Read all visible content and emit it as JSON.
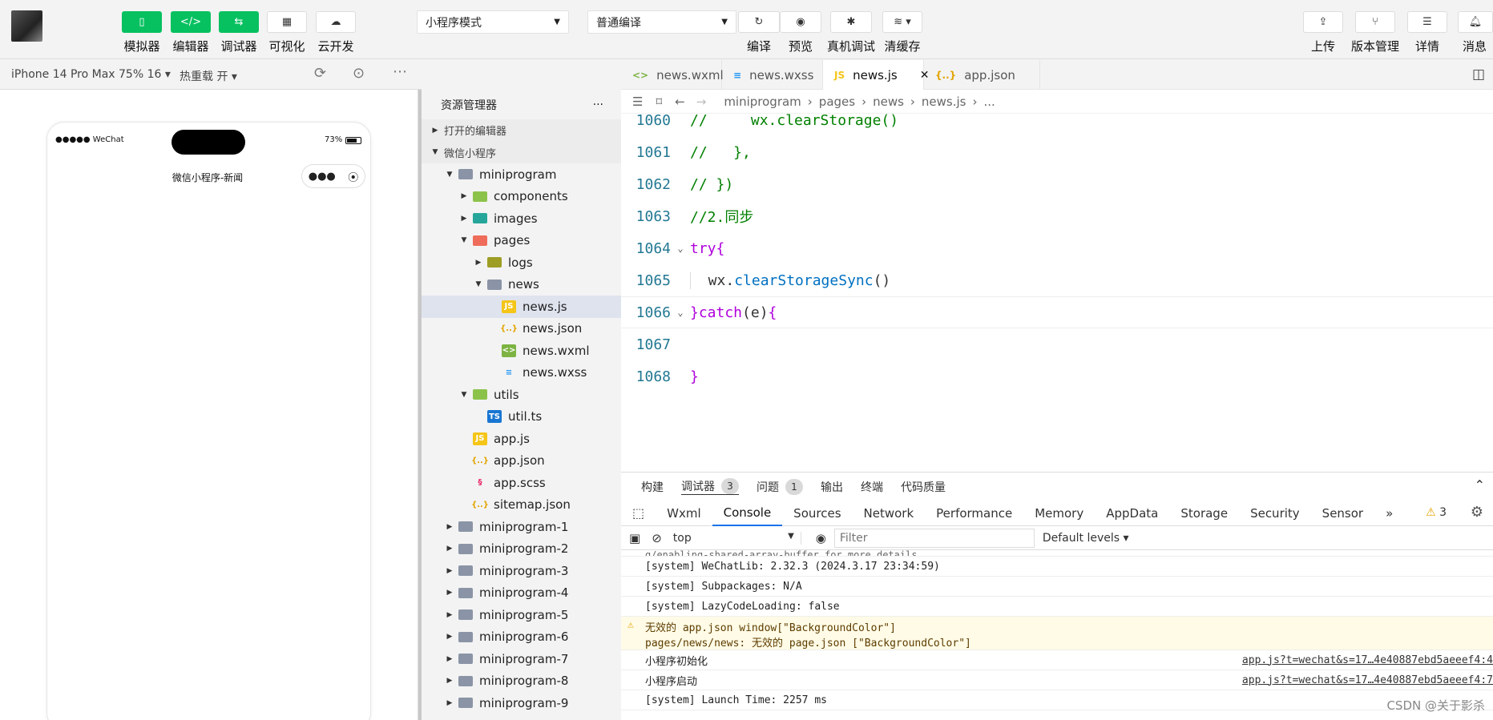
{
  "toolbar": {
    "buttons": [
      {
        "label": "模拟器",
        "icon": "phone-icon"
      },
      {
        "label": "编辑器",
        "icon": "code-icon"
      },
      {
        "label": "调试器",
        "icon": "sliders-icon"
      },
      {
        "label": "可视化",
        "icon": "layout-icon"
      },
      {
        "label": "云开发",
        "icon": "cloud-icon"
      }
    ],
    "mode_select": "小程序模式",
    "compile_select": "普通编译",
    "actions": [
      {
        "label": "编译",
        "icon": "refresh-icon"
      },
      {
        "label": "预览",
        "icon": "eye-icon"
      },
      {
        "label": "真机调试",
        "icon": "bug-icon"
      },
      {
        "label": "清缓存",
        "icon": "layers-icon"
      }
    ],
    "right_actions": [
      {
        "label": "上传",
        "icon": "upload-icon"
      },
      {
        "label": "版本管理",
        "icon": "branch-icon"
      },
      {
        "label": "详情",
        "icon": "menu-icon"
      },
      {
        "label": "消息",
        "icon": "bell-icon"
      }
    ]
  },
  "simulator": {
    "device": "iPhone 14 Pro Max 75% 16 ▾",
    "hot_reload": "热重载 开 ▾",
    "status_left": "●●●●● WeChat",
    "battery": "73%",
    "page_title": "微信小程序-新闻"
  },
  "explorer": {
    "title": "资源管理器",
    "more": "···",
    "section_open": "打开的编辑器",
    "section_project": "微信小程序",
    "items": [
      {
        "label": "miniprogram",
        "indent": 1,
        "tw": "▼",
        "type": "folder"
      },
      {
        "label": "components",
        "indent": 2,
        "tw": "▶",
        "type": "folder-green"
      },
      {
        "label": "images",
        "indent": 2,
        "tw": "▶",
        "type": "folder-teal"
      },
      {
        "label": "pages",
        "indent": 2,
        "tw": "▼",
        "type": "folder-red"
      },
      {
        "label": "logs",
        "indent": 3,
        "tw": "▶",
        "type": "folder-olive"
      },
      {
        "label": "news",
        "indent": 3,
        "tw": "▼",
        "type": "folder"
      },
      {
        "label": "news.js",
        "indent": 4,
        "tw": "",
        "type": "js",
        "selected": true
      },
      {
        "label": "news.json",
        "indent": 4,
        "tw": "",
        "type": "json"
      },
      {
        "label": "news.wxml",
        "indent": 4,
        "tw": "",
        "type": "wxml"
      },
      {
        "label": "news.wxss",
        "indent": 4,
        "tw": "",
        "type": "wxss"
      },
      {
        "label": "utils",
        "indent": 2,
        "tw": "▼",
        "type": "folder-green"
      },
      {
        "label": "util.ts",
        "indent": 3,
        "tw": "",
        "type": "ts"
      },
      {
        "label": "app.js",
        "indent": 2,
        "tw": "",
        "type": "js"
      },
      {
        "label": "app.json",
        "indent": 2,
        "tw": "",
        "type": "json"
      },
      {
        "label": "app.scss",
        "indent": 2,
        "tw": "",
        "type": "scss"
      },
      {
        "label": "sitemap.json",
        "indent": 2,
        "tw": "",
        "type": "json"
      },
      {
        "label": "miniprogram-1",
        "indent": 1,
        "tw": "▶",
        "type": "folder"
      },
      {
        "label": "miniprogram-2",
        "indent": 1,
        "tw": "▶",
        "type": "folder"
      },
      {
        "label": "miniprogram-3",
        "indent": 1,
        "tw": "▶",
        "type": "folder"
      },
      {
        "label": "miniprogram-4",
        "indent": 1,
        "tw": "▶",
        "type": "folder"
      },
      {
        "label": "miniprogram-5",
        "indent": 1,
        "tw": "▶",
        "type": "folder"
      },
      {
        "label": "miniprogram-6",
        "indent": 1,
        "tw": "▶",
        "type": "folder"
      },
      {
        "label": "miniprogram-7",
        "indent": 1,
        "tw": "▶",
        "type": "folder"
      },
      {
        "label": "miniprogram-8",
        "indent": 1,
        "tw": "▶",
        "type": "folder"
      },
      {
        "label": "miniprogram-9",
        "indent": 1,
        "tw": "▶",
        "type": "folder"
      }
    ]
  },
  "editor": {
    "tabs": [
      {
        "label": "news.wxml",
        "type": "wxml"
      },
      {
        "label": "news.wxss",
        "type": "wxss"
      },
      {
        "label": "news.js",
        "type": "js",
        "active": true
      },
      {
        "label": "app.json",
        "type": "json"
      }
    ],
    "breadcrumb": [
      "miniprogram",
      "pages",
      "news",
      "news.js",
      "..."
    ],
    "lines": [
      {
        "n": "1060",
        "parts": [
          [
            "cmt",
            "//     wx.clearStorage()"
          ]
        ]
      },
      {
        "n": "1061",
        "parts": [
          [
            "cmt",
            "//   },"
          ]
        ]
      },
      {
        "n": "1062",
        "parts": [
          [
            "cmt",
            "// })"
          ]
        ]
      },
      {
        "n": "1063",
        "parts": [
          [
            "cmt",
            "//2.同步"
          ]
        ]
      },
      {
        "n": "1064",
        "fold": "⌄",
        "parts": [
          [
            "kw",
            "try"
          ],
          [
            "kw",
            "{"
          ]
        ]
      },
      {
        "n": "1065",
        "parts": [
          [
            "pl",
            "  wx."
          ],
          [
            "fn",
            "clearStorageSync"
          ],
          [
            "pl",
            "()"
          ]
        ]
      },
      {
        "n": "1066",
        "fold": "⌄",
        "parts": [
          [
            "kw",
            "}catch"
          ],
          [
            "pl",
            "(e)"
          ],
          [
            "kw",
            "{"
          ]
        ]
      },
      {
        "n": "1067",
        "parts": []
      },
      {
        "n": "1068",
        "parts": [
          [
            "kw",
            "}"
          ]
        ]
      }
    ]
  },
  "panel": {
    "tabs": [
      {
        "label": "构建"
      },
      {
        "label": "调试器",
        "badge": "3"
      },
      {
        "label": "问题",
        "badge": "1"
      },
      {
        "label": "输出"
      },
      {
        "label": "终端"
      },
      {
        "label": "代码质量"
      }
    ],
    "devtabs": [
      "Wxml",
      "Console",
      "Sources",
      "Network",
      "Performance",
      "Memory",
      "AppData",
      "Storage",
      "Security",
      "Sensor"
    ],
    "devtabs_more": "»",
    "warn_count": "3",
    "context": "top",
    "filter_placeholder": "Filter",
    "levels": "Default levels ▾",
    "logs": [
      {
        "text": "[system] WeChatLib: 2.32.3 (2024.3.17 23:34:59)"
      },
      {
        "text": "[system] Subpackages: N/A"
      },
      {
        "text": "[system] LazyCodeLoading: false"
      },
      {
        "text": "无效的 app.json window[\"BackgroundColor\"]",
        "text2": "pages/news/news: 无效的 page.json [\"BackgroundColor\"]",
        "warn": true
      },
      {
        "text": "小程序初始化",
        "src": "app.js?t=wechat&s=17…4e40887ebd5aeeef4:4"
      },
      {
        "text": "小程序启动",
        "src": "app.js?t=wechat&s=17…4e40887ebd5aeeef4:7"
      },
      {
        "text": "[system] Launch Time: 2257 ms"
      }
    ],
    "partial_top": "g/enabling-shared-array-buffer for more details."
  },
  "watermark": "CSDN @关于影杀"
}
